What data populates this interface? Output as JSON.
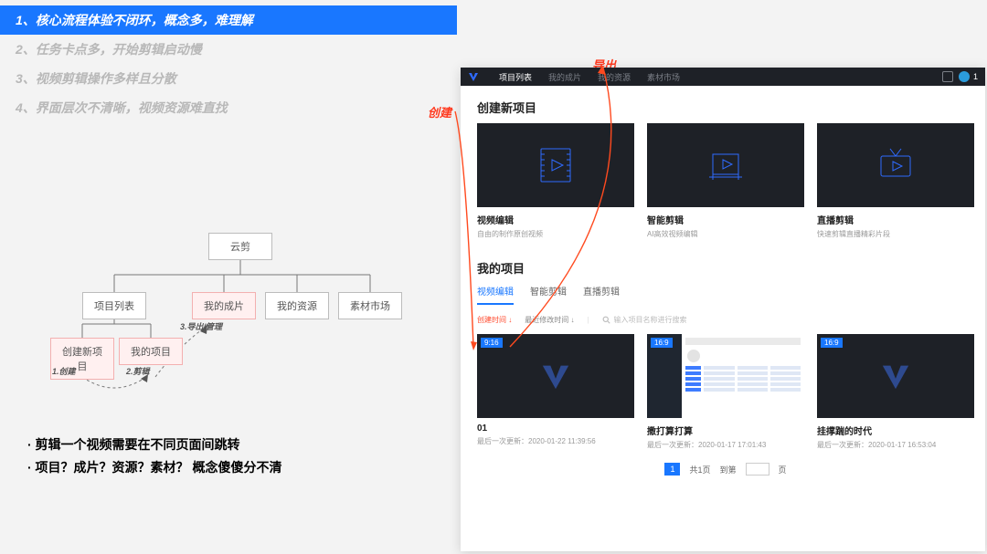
{
  "issues": [
    "1、核心流程体验不闭环，概念多，难理解",
    "2、任务卡点多，开始剪辑启动慢",
    "3、视频剪辑操作多样且分散",
    "4、界面层次不清晰，视频资源难直找"
  ],
  "tree": {
    "root": "云剪",
    "level1": [
      "项目列表",
      "我的成片",
      "我的资源",
      "素材市场"
    ],
    "level2": [
      "创建新项目",
      "我的项目"
    ],
    "labels": [
      "1.创建",
      "2.剪辑",
      "3.导出/管理"
    ]
  },
  "conclusion": [
    "· 剪辑一个视频需要在不同页面间跳转",
    "· 项目？成片？资源？素材？ 概念傻傻分不清"
  ],
  "annotations": {
    "create": "创建",
    "export": "导出",
    "edit": "剪辑"
  },
  "app": {
    "nav": {
      "items": [
        "项目列表",
        "我的成片",
        "我的资源",
        "素材市场"
      ],
      "badge": "1"
    },
    "createSection": {
      "title": "创建新项目",
      "cards": [
        {
          "name": "视频编辑",
          "sub": "自由的制作原创视频"
        },
        {
          "name": "智能剪辑",
          "sub": "AI高效视频编辑"
        },
        {
          "name": "直播剪辑",
          "sub": "快速剪辑直播精彩片段"
        }
      ]
    },
    "mySection": {
      "title": "我的项目",
      "tabs": [
        "视频编辑",
        "智能剪辑",
        "直播剪辑"
      ],
      "filters": [
        "创建时间 ↓",
        "最近修改时间 ↓"
      ],
      "searchPlaceholder": "输入项目名称进行搜索",
      "projects": [
        {
          "badge": "9:16",
          "name": "01",
          "timeLabel": "最后一次更新：",
          "time": "2020-01-22 11:39:56"
        },
        {
          "badge": "16:9",
          "name": "撒打算打算",
          "timeLabel": "最后一次更新：",
          "time": "2020-01-17 17:01:43"
        },
        {
          "badge": "16:9",
          "name": "挂撑踹的时代",
          "timeLabel": "最后一次更新：",
          "time": "2020-01-17 16:53:04"
        }
      ],
      "pager": {
        "current": "1",
        "text1": "共1页",
        "text2": "到第",
        "text3": "页"
      }
    }
  }
}
